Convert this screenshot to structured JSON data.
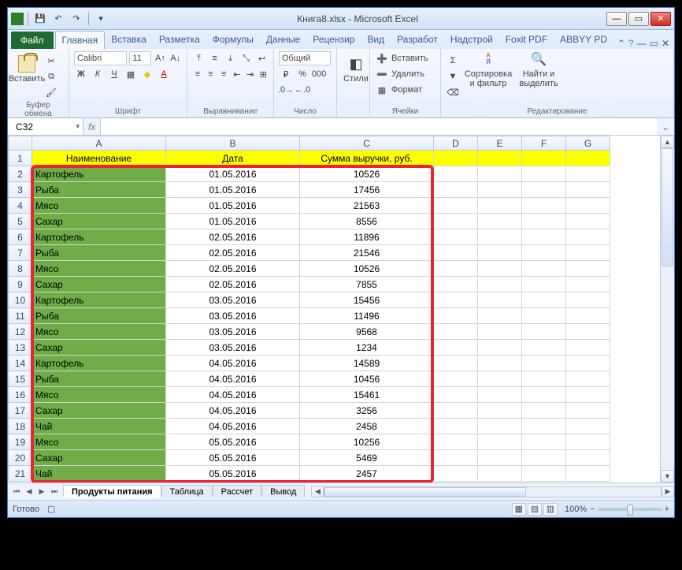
{
  "title": "Книга8.xlsx - Microsoft Excel",
  "qat": {
    "save": "💾",
    "undo": "↶",
    "redo": "↷"
  },
  "tabs": {
    "file": "Файл",
    "list": [
      "Главная",
      "Вставка",
      "Разметка",
      "Формулы",
      "Данные",
      "Рецензир",
      "Вид",
      "Разработ",
      "Надстрой",
      "Foxit PDF",
      "ABBYY PD"
    ],
    "active_index": 0
  },
  "ribbon": {
    "clipboard": {
      "paste": "Вставить",
      "label": "Буфер обмена"
    },
    "font": {
      "name": "Calibri",
      "size": "11",
      "label": "Шрифт"
    },
    "align": {
      "label": "Выравнивание"
    },
    "number": {
      "format": "Общий",
      "label": "Число"
    },
    "styles": {
      "btn": "Стили"
    },
    "cells": {
      "insert": "Вставить",
      "delete": "Удалить",
      "format": "Формат",
      "label": "Ячейки"
    },
    "editing": {
      "sort": "Сортировка и фильтр",
      "find": "Найти и выделить",
      "label": "Редактирование"
    }
  },
  "namebox": "C32",
  "fx": "fx",
  "columns": [
    "A",
    "B",
    "C",
    "D",
    "E",
    "F",
    "G"
  ],
  "header_row": [
    "Наименование",
    "Дата",
    "Сумма выручки, руб."
  ],
  "rows": [
    [
      "Картофель",
      "01.05.2016",
      "10526"
    ],
    [
      "Рыба",
      "01.05.2016",
      "17456"
    ],
    [
      "Мясо",
      "01.05.2016",
      "21563"
    ],
    [
      "Сахар",
      "01.05.2016",
      "8556"
    ],
    [
      "Картофель",
      "02.05.2016",
      "11896"
    ],
    [
      "Рыба",
      "02.05.2016",
      "21546"
    ],
    [
      "Мясо",
      "02.05.2016",
      "10526"
    ],
    [
      "Сахар",
      "02.05.2016",
      "7855"
    ],
    [
      "Картофель",
      "03.05.2016",
      "15456"
    ],
    [
      "Рыба",
      "03.05.2016",
      "11496"
    ],
    [
      "Мясо",
      "03.05.2016",
      "9568"
    ],
    [
      "Сахар",
      "03.05.2016",
      "1234"
    ],
    [
      "Картофель",
      "04.05.2016",
      "14589"
    ],
    [
      "Рыба",
      "04.05.2016",
      "10456"
    ],
    [
      "Мясо",
      "04.05.2016",
      "15461"
    ],
    [
      "Сахар",
      "04.05.2016",
      "3256"
    ],
    [
      "Чай",
      "04.05.2016",
      "2458"
    ],
    [
      "Мясо",
      "05.05.2016",
      "10256"
    ],
    [
      "Сахар",
      "05.05.2016",
      "5469"
    ],
    [
      "Чай",
      "05.05.2016",
      "2457"
    ]
  ],
  "sheet_tabs": [
    "Продукты питания",
    "Таблица",
    "Рассчет",
    "Вывод"
  ],
  "active_sheet": 0,
  "status": {
    "ready": "Готово",
    "zoom": "100%"
  }
}
